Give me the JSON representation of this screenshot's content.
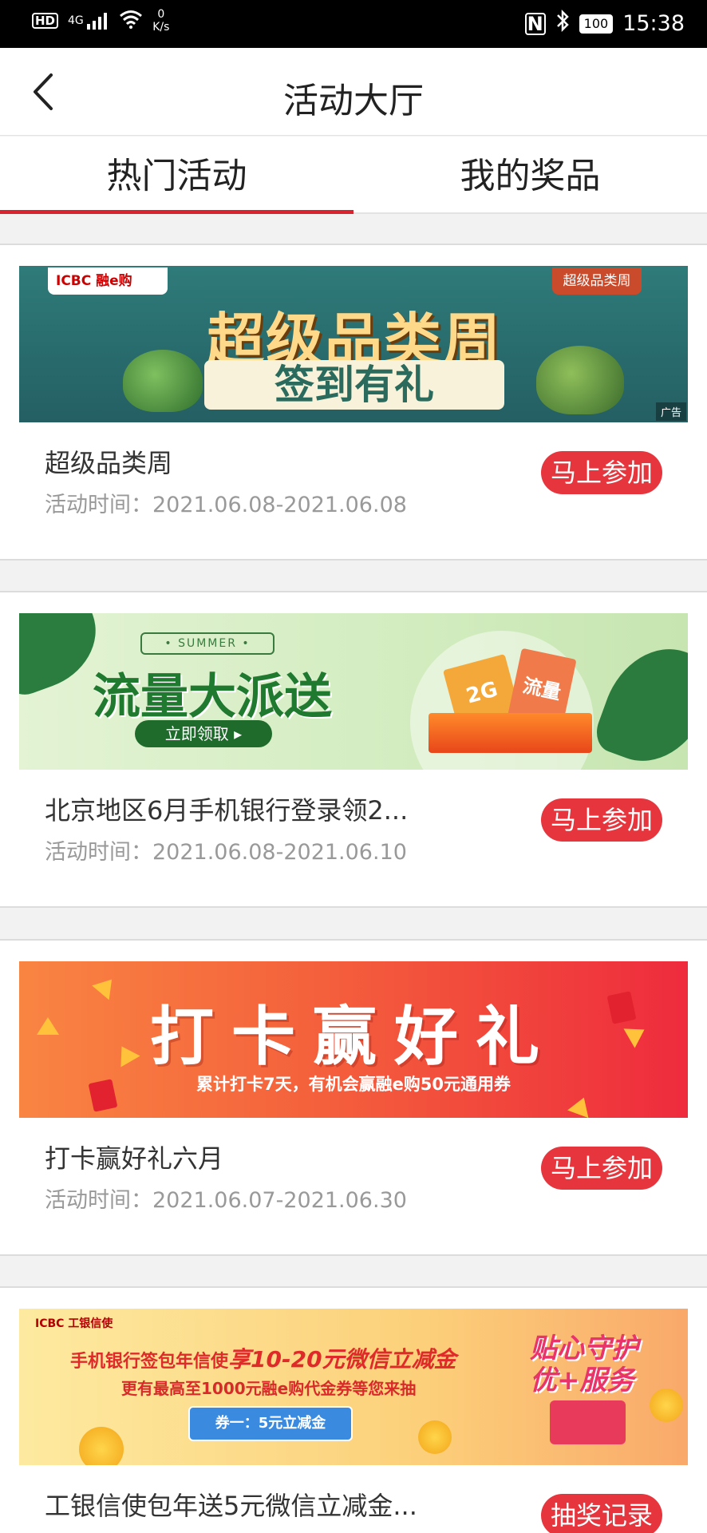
{
  "status_bar": {
    "hd": "HD",
    "signal": "4G",
    "net_speed_value": "0",
    "net_speed_unit": "K/s",
    "nfc": "N",
    "battery": "100",
    "time": "15:38"
  },
  "header": {
    "title": "活动大厅"
  },
  "tabs": [
    {
      "label": "热门活动",
      "active": true
    },
    {
      "label": "我的奖品",
      "active": false
    }
  ],
  "activities": [
    {
      "title": "超级品类周",
      "time": "活动时间：2021.06.08-2021.06.08",
      "button": "马上参加",
      "banner": {
        "logo": "ICBC 融e购",
        "corner": "超级品类周",
        "headline": "超级品类周",
        "subline": "签到有礼",
        "ad_tag": "广告"
      }
    },
    {
      "title": "北京地区6月手机银行登录领2...",
      "time": "活动时间：2021.06.08-2021.06.10",
      "button": "马上参加",
      "banner": {
        "tag": "• SUMMER •",
        "headline": "流量大派送",
        "cta": "立即领取 ▸",
        "card_a": "2G",
        "card_b": "流量"
      }
    },
    {
      "title": "打卡赢好礼六月",
      "time": "活动时间：2021.06.07-2021.06.30",
      "button": "马上参加",
      "banner": {
        "headline": "打卡赢好礼",
        "subline": "累计打卡7天，有机会赢融e购50元通用券"
      }
    },
    {
      "title": "工银信使包年送5元微信立减金...",
      "button": "抽奖记录",
      "banner": {
        "logo": "ICBC 工银信使",
        "line1_prefix": "手机银行签包年信使",
        "line1_emph": "享10-20元微信立减金",
        "line2": "更有最高至1000元融e购代金券等您来抽",
        "coupon": "券一：5元立减金",
        "right_text_1": "贴心守护",
        "right_text_2": "优+服务"
      }
    }
  ],
  "colors": {
    "accent": "#d9232e",
    "button": "#e6353d"
  }
}
